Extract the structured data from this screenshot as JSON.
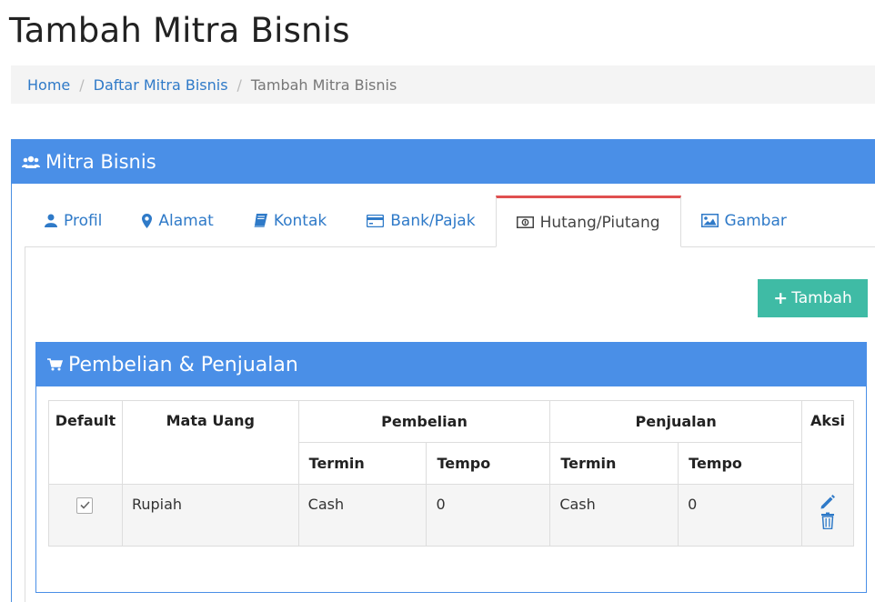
{
  "page": {
    "title": "Tambah Mitra Bisnis"
  },
  "breadcrumb": {
    "home": "Home",
    "list": "Daftar Mitra Bisnis",
    "current": "Tambah Mitra Bisnis",
    "separator": "/"
  },
  "panel": {
    "title": "Mitra Bisnis",
    "icon": "users-icon"
  },
  "tabs": [
    {
      "label": "Profil",
      "icon": "user-icon"
    },
    {
      "label": "Alamat",
      "icon": "map-marker-icon"
    },
    {
      "label": "Kontak",
      "icon": "book-icon"
    },
    {
      "label": "Bank/Pajak",
      "icon": "credit-card-icon"
    },
    {
      "label": "Hutang/Piutang",
      "icon": "money-icon",
      "active": true
    },
    {
      "label": "Gambar",
      "icon": "image-icon"
    }
  ],
  "add_button": {
    "label": "Tambah",
    "icon": "plus-icon"
  },
  "section": {
    "title": "Pembelian & Penjualan",
    "icon": "cart-icon"
  },
  "table": {
    "headers": {
      "default": "Default",
      "currency": "Mata Uang",
      "purchase": "Pembelian",
      "sales": "Penjualan",
      "actions": "Aksi",
      "term": "Termin",
      "tempo": "Tempo"
    },
    "rows": [
      {
        "default_checked": true,
        "currency": "Rupiah",
        "purchase_term": "Cash",
        "purchase_tempo": "0",
        "sales_term": "Cash",
        "sales_tempo": "0"
      }
    ]
  },
  "colors": {
    "primary": "#4a8fe7",
    "accent_green": "#3fbba5",
    "active_tab_border": "#e05050",
    "link": "#2f7ac8"
  }
}
